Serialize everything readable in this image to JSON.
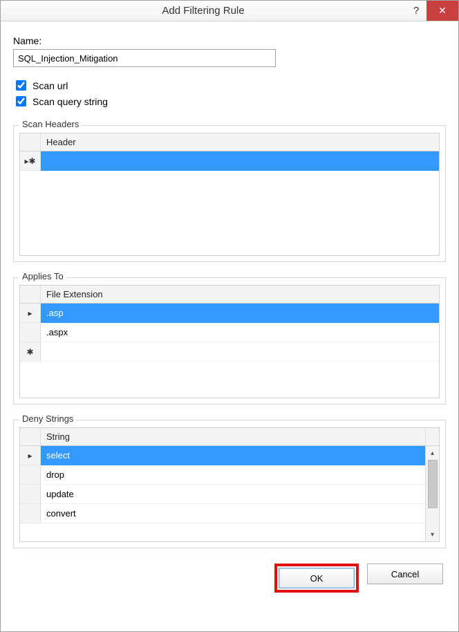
{
  "titlebar": {
    "title": "Add Filtering Rule",
    "help_glyph": "?",
    "close_glyph": "✕"
  },
  "name": {
    "label": "Name:",
    "value": "SQL_Injection_Mitigation"
  },
  "scan_url": {
    "label": "Scan url",
    "checked": true
  },
  "scan_query_string": {
    "label": "Scan query string",
    "checked": true
  },
  "scan_headers": {
    "legend": "Scan Headers",
    "column": "Header",
    "new_row_glyph": "▸✱",
    "rows": []
  },
  "applies_to": {
    "legend": "Applies To",
    "column": "File Extension",
    "selected_glyph": "▸",
    "new_row_glyph": "✱",
    "rows": [
      {
        "value": ".asp",
        "selected": true
      },
      {
        "value": ".aspx",
        "selected": false
      }
    ]
  },
  "deny_strings": {
    "legend": "Deny Strings",
    "column": "String",
    "selected_glyph": "▸",
    "scroll_up_glyph": "▴",
    "scroll_down_glyph": "▾",
    "rows": [
      {
        "value": "select",
        "selected": true
      },
      {
        "value": "drop",
        "selected": false
      },
      {
        "value": "update",
        "selected": false
      },
      {
        "value": "convert",
        "selected": false
      }
    ]
  },
  "buttons": {
    "ok": "OK",
    "cancel": "Cancel"
  }
}
